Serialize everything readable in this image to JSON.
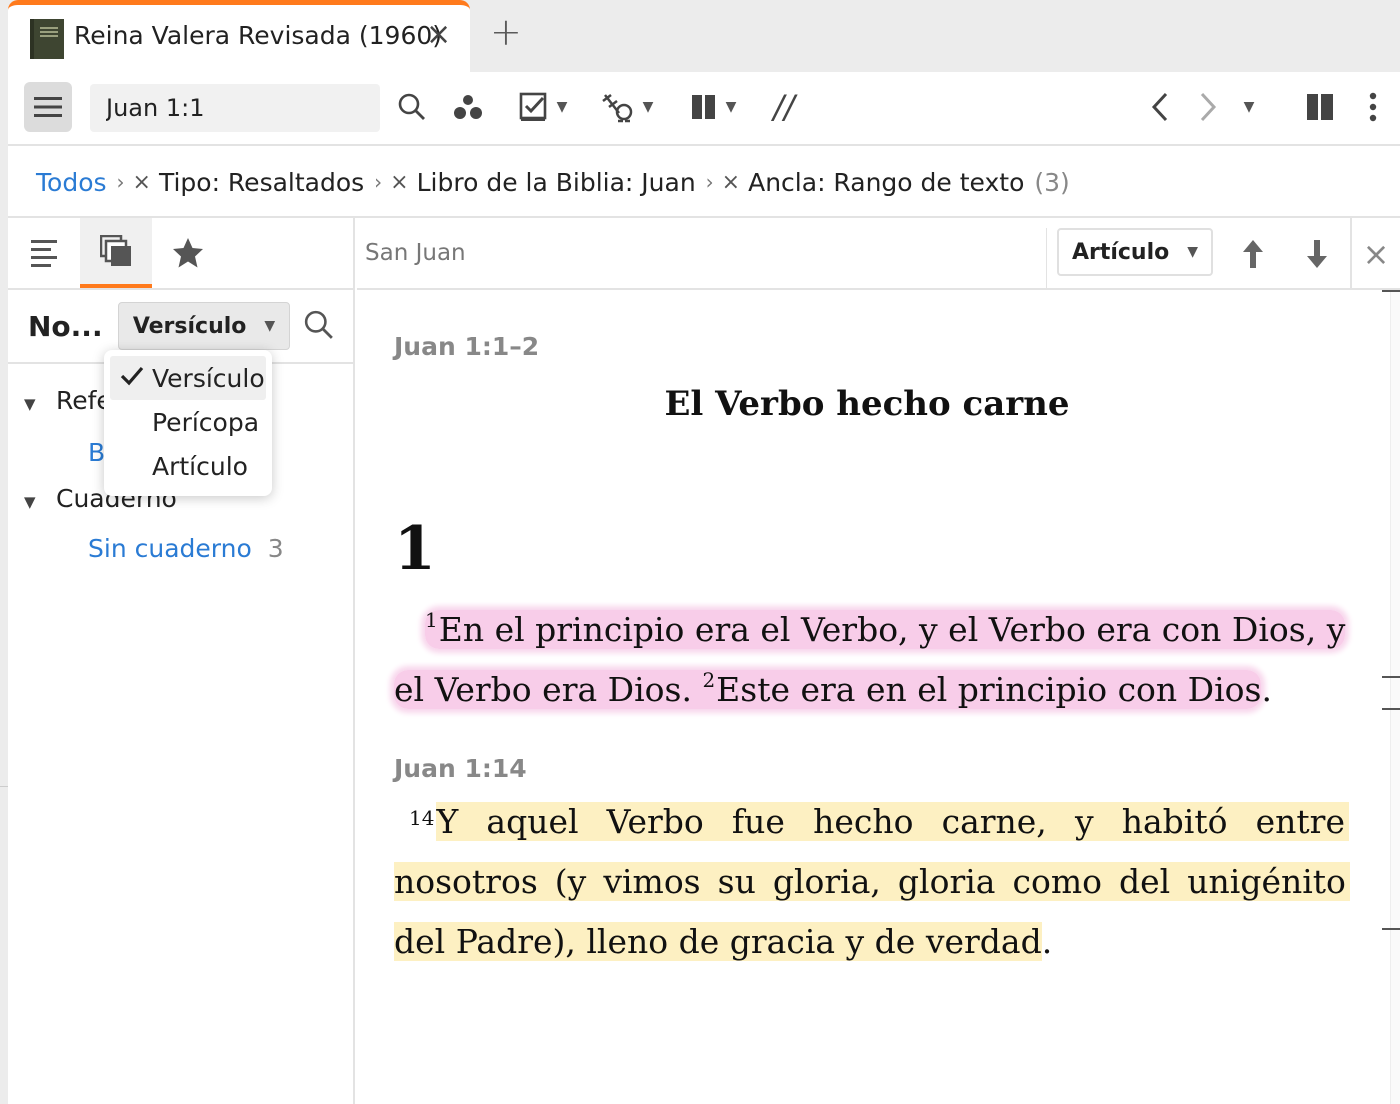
{
  "tab": {
    "title": "Reina Valera Revisada (1960)",
    "close": "×",
    "add": "+"
  },
  "toolbar": {
    "reference_value": "Juan 1:1",
    "parallel_label": "//"
  },
  "breadcrumb": {
    "root": "Todos",
    "filters": [
      "Tipo: Resaltados",
      "Libro de la Biblia: Juan",
      "Ancla: Rango de texto"
    ],
    "count": "(3)"
  },
  "left": {
    "title": "No...",
    "group_by": "Versículo",
    "tree": [
      {
        "label": "Refe",
        "children": [
          {
            "label": "B",
            "count": ""
          }
        ]
      },
      {
        "label": "Cuaderno",
        "children": [
          {
            "label": "Sin cuaderno",
            "count": "3"
          }
        ]
      }
    ],
    "dropdown_options": [
      "Versículo",
      "Perícopa",
      "Artículo"
    ],
    "dropdown_selected": "Versículo"
  },
  "right": {
    "title": "San Juan",
    "view_mode": "Artículo",
    "close": "×"
  },
  "passages": [
    {
      "ref": "Juan 1:1–2",
      "heading": "El Verbo hecho carne",
      "chapter": "1",
      "lines": [
        {
          "v": "1",
          "text": "En el principio era el Verbo, y el Verbo era con Dios, y"
        },
        {
          "text": "el Verbo era Dios.",
          "v2": "2",
          "text2": "Este era en el principio con Dios",
          "tail": "."
        }
      ],
      "highlight": "#f8cde9"
    },
    {
      "ref": "Juan 1:14",
      "lines": [
        {
          "v": "14",
          "words": [
            "Y",
            "aquel",
            "Verbo",
            "fue",
            "hecho",
            "carne,",
            "y",
            "habitó",
            "entre"
          ]
        },
        {
          "words": [
            "nosotros",
            "(y",
            "vimos",
            "su",
            "gloria,",
            "gloria",
            "como",
            "del",
            "unigénito"
          ]
        },
        {
          "text": "del Padre), lleno de gracia y de verdad",
          "tail": "."
        }
      ],
      "highlight": "#fdf0c2"
    }
  ],
  "colors": {
    "accent": "#ff7a1c",
    "link": "#2a7bd4",
    "pink_highlight": "#f8cde9",
    "yellow_highlight": "#fdf0c2"
  }
}
